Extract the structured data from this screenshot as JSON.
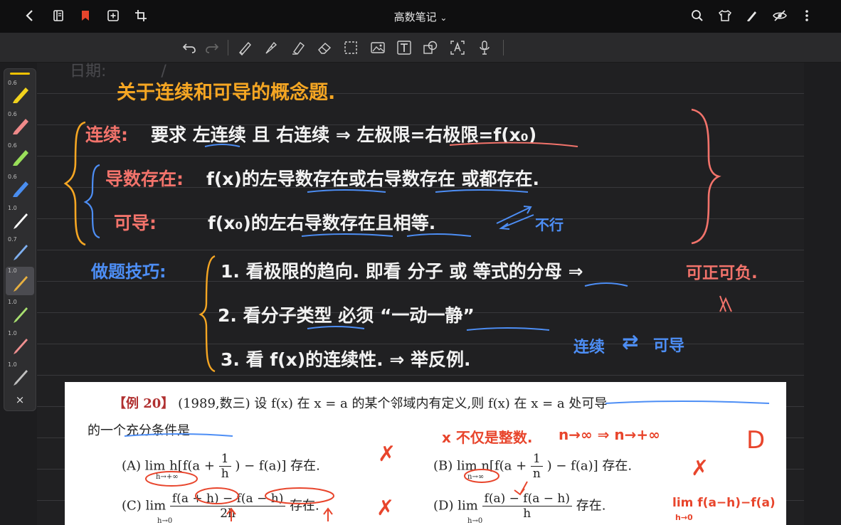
{
  "app": {
    "title": "高数笔记",
    "title_chevron": "⌄"
  },
  "topbar": {
    "left_icons": [
      "back-icon",
      "page-list-icon",
      "bookmark-icon",
      "add-page-icon",
      "crop-icon"
    ],
    "right_icons": [
      "search-icon",
      "template-icon",
      "pen-icon",
      "hide-icon",
      "more-icon"
    ],
    "bookmark_color": "#e8452c"
  },
  "toolbar": {
    "tools": [
      "undo-icon",
      "redo-icon",
      "pencil-icon",
      "pen-icon",
      "highlighter-icon",
      "eraser-icon",
      "lasso-icon",
      "image-icon",
      "text-icon",
      "shape-icon",
      "ocr-icon",
      "microphone-icon"
    ]
  },
  "palette": {
    "pens": [
      {
        "width": "0.6",
        "color": "#f2d31d"
      },
      {
        "width": "0.6",
        "color": "#f08a8a"
      },
      {
        "width": "0.6",
        "color": "#9ae05a"
      },
      {
        "width": "0.6",
        "color": "#4a8ef0"
      },
      {
        "width": "1.0",
        "color": "#ffffff"
      },
      {
        "width": "0.7",
        "color": "#7fb0f0"
      },
      {
        "width": "1.0",
        "color": "#e8b040"
      },
      {
        "width": "1.0",
        "color": "#a8e070"
      },
      {
        "width": "1.0",
        "color": "#f09090"
      },
      {
        "width": "1.0",
        "color": "#c0c0c0"
      }
    ],
    "selected_index": 6,
    "close_label": "×"
  },
  "note": {
    "date_label": "日期:",
    "date_slash": "/",
    "title": "关于连续和可导的概念题.",
    "line1_label": "连续:",
    "line1_text": "要求 左连续 且 右连续  ⇒ 左极限=右极限=f(x₀)",
    "line2_label": "导数存在:",
    "line2_text": "f(x)的左导数存在或右导数存在 或都存在.",
    "line3_label": "可导:",
    "line3_text": "f(x₀)的左右导数存在且相等.",
    "side_note": "不行",
    "tips_label": "做题技巧:",
    "tip1": "1. 看极限的趋向. 即看 分子 或 等式的分母  ⇒",
    "tip1_result": "可正可负.",
    "tip2": "2. 看分子类型 必须 “一动一静”",
    "tip3": "3. 看 f(x)的连续性. ⇒ 举反例.",
    "relation_left": "连续",
    "relation_right": "可导",
    "relation_arrows": "⇄",
    "colors": {
      "orange": "#f5a623",
      "white": "#f2f2f2",
      "blue": "#4d8ef5",
      "pink": "#f2736b"
    }
  },
  "excerpt": {
    "label": "【例 20】",
    "stem_1": "(1989,数三) 设 f(x) 在 x = a 的某个邻域内有定义,则 f(x) 在 x = a 处可导",
    "stem_2": "的一个充分条件是",
    "options": [
      {
        "tag": "(A)",
        "lim": "lim",
        "sub": "h→+∞",
        "expr_pre": "h[f(a +",
        "frac_n": "1",
        "frac_d": "h",
        "expr_post": ") − f(a)] 存在."
      },
      {
        "tag": "(B)",
        "lim": "lim",
        "sub": "n→∞",
        "expr_pre": "n[f(a +",
        "frac_n": "1",
        "frac_d": "n",
        "expr_post": ") − f(a)] 存在."
      },
      {
        "tag": "(C)",
        "lim": "lim",
        "sub": "h→0",
        "frac_n": "f(a + h) − f(a − h)",
        "frac_d": "2h",
        "expr_post": "存在."
      },
      {
        "tag": "(D)",
        "lim": "lim",
        "sub": "h→0",
        "frac_n": "f(a) − f(a − h)",
        "frac_d": "h",
        "expr_post": "存在."
      }
    ],
    "annotations": {
      "note_A": "✗",
      "note_B": "✗",
      "note_C": "✗",
      "note_x_not_limited": "x 不仅是整数.",
      "note_n_limit": "n→∞ ⇒ n→+∞",
      "answer": "D",
      "note_D_lim": "lim f(a−h)−f(a)",
      "note_D_sub": "h→0"
    }
  }
}
